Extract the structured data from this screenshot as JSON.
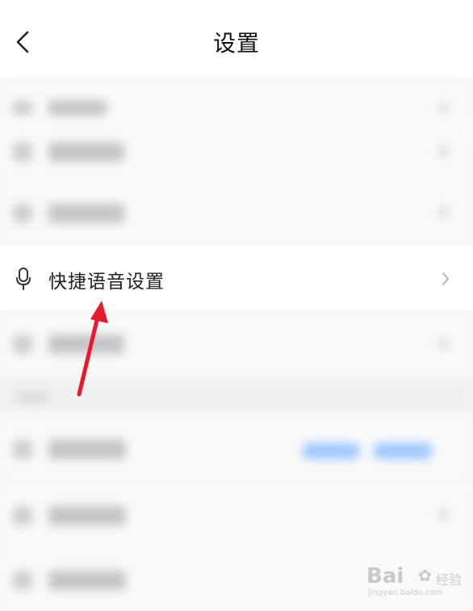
{
  "header": {
    "title": "设置",
    "back_icon": "chevron-left-icon"
  },
  "focused_item": {
    "label": "快捷语音设置",
    "icon": "microphone-icon",
    "trailing_icon": "chevron-right-icon"
  },
  "watermark": {
    "logo_text": "Bai",
    "logo_suffix": "经验",
    "sub_text": "jingyan.baidu.com"
  },
  "colors": {
    "background": "#f5f5f7",
    "row_background": "#ffffff",
    "text": "#222222",
    "annotation_arrow": "#e8192c",
    "blurred_pill": "#8fc0ff"
  }
}
